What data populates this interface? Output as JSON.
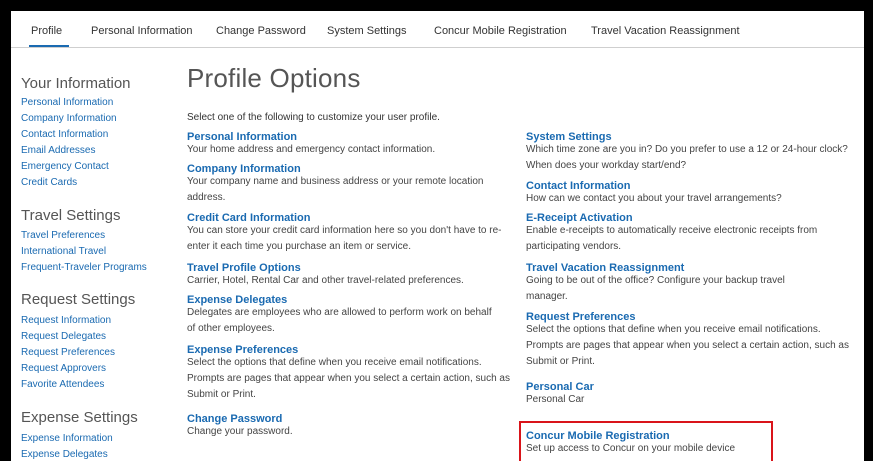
{
  "tabs": [
    {
      "label": "Profile"
    },
    {
      "label": "Personal Information"
    },
    {
      "label": "Change Password"
    },
    {
      "label": "System Settings"
    },
    {
      "label": "Concur Mobile Registration"
    },
    {
      "label": "Travel Vacation Reassignment"
    }
  ],
  "sidebar": {
    "sections": [
      {
        "heading": "Your Information",
        "links": [
          "Personal Information",
          "Company Information",
          "Contact Information",
          "Email Addresses",
          "Emergency Contact",
          "Credit Cards"
        ]
      },
      {
        "heading": "Travel Settings",
        "links": [
          "Travel Preferences",
          "International Travel",
          "Frequent-Traveler Programs"
        ]
      },
      {
        "heading": "Request Settings",
        "links": [
          "Request Information",
          "Request Delegates",
          "Request Preferences",
          "Request Approvers",
          "Favorite Attendees"
        ]
      },
      {
        "heading": "Expense Settings",
        "links": [
          "Expense Information",
          "Expense Delegates"
        ]
      }
    ]
  },
  "main": {
    "title": "Profile Options",
    "intro": "Select one of the following to customize your user profile.",
    "left_options": [
      {
        "title": "Personal Information",
        "desc": "Your home address and emergency contact information."
      },
      {
        "title": "Company Information",
        "desc": "Your company name and business address or your remote location address."
      },
      {
        "title": "Credit Card Information",
        "desc": "You can store your credit card information here so you don't have to re-enter it each time you purchase an item or service."
      },
      {
        "title": "Travel Profile Options",
        "desc": "Carrier, Hotel, Rental Car and other travel-related preferences."
      },
      {
        "title": "Expense Delegates",
        "desc": "Delegates are employees who are allowed to perform work on behalf of other employees."
      },
      {
        "title": "Expense Preferences",
        "desc": "Select the options that define when you receive email notifications. Prompts are pages that appear when you select a certain action, such as Submit or Print."
      },
      {
        "title": "Change Password",
        "desc": "Change your password."
      }
    ],
    "right_options": [
      {
        "title": "System Settings",
        "desc": "Which time zone are you in? Do you prefer to use a 12 or 24-hour clock? When does your workday start/end?"
      },
      {
        "title": "Contact Information",
        "desc": "How can we contact you about your travel arrangements?"
      },
      {
        "title": "E-Receipt Activation",
        "desc": "Enable e-receipts to automatically receive electronic receipts from participating vendors."
      },
      {
        "title": "Travel Vacation Reassignment",
        "desc": "Going to be out of the office? Configure your backup travel manager."
      },
      {
        "title": "Request Preferences",
        "desc": "Select the options that define when you receive email notifications. Prompts are pages that appear when you select a certain action, such as Submit or Print."
      },
      {
        "title": "Personal Car",
        "desc": "Personal Car"
      },
      {
        "title": "Concur Mobile Registration",
        "desc": "Set up access to Concur on your mobile device"
      }
    ]
  },
  "colors": {
    "link": "#1a6ab1",
    "highlight": "#d9141a"
  }
}
